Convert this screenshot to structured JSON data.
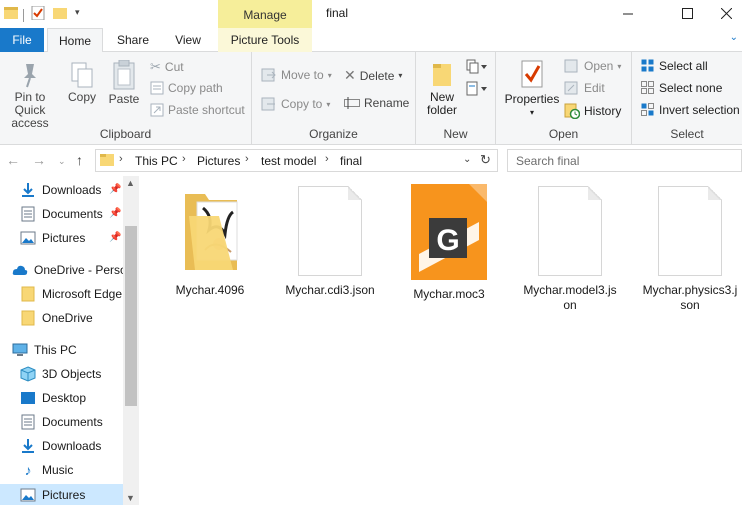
{
  "window": {
    "title": "final",
    "manage_label": "Manage",
    "minimize": "—",
    "maximize": "☐",
    "close": "✕"
  },
  "tabs": {
    "file": "File",
    "home": "Home",
    "share": "Share",
    "view": "View",
    "picture_tools": "Picture Tools"
  },
  "ribbon": {
    "clipboard": {
      "label": "Clipboard",
      "pin_line1": "Pin to Quick",
      "pin_line2": "access",
      "copy": "Copy",
      "paste": "Paste",
      "cut": "Cut",
      "copy_path": "Copy path",
      "paste_shortcut": "Paste shortcut"
    },
    "organize": {
      "label": "Organize",
      "move_to": "Move to",
      "copy_to": "Copy to",
      "delete": "Delete",
      "rename": "Rename"
    },
    "new": {
      "label": "New",
      "new_folder_line1": "New",
      "new_folder_line2": "folder"
    },
    "open": {
      "label": "Open",
      "properties": "Properties",
      "open": "Open",
      "edit": "Edit",
      "history": "History"
    },
    "select": {
      "label": "Select",
      "select_all": "Select all",
      "select_none": "Select none",
      "invert_selection": "Invert selection"
    }
  },
  "address": {
    "crumbs": [
      "This PC",
      "Pictures",
      "test model",
      "final"
    ],
    "search_placeholder": "Search final"
  },
  "sidebar": {
    "quick": [
      {
        "label": "Downloads",
        "icon": "downloads-icon",
        "pinned": true
      },
      {
        "label": "Documents",
        "icon": "documents-icon",
        "pinned": true
      },
      {
        "label": "Pictures",
        "icon": "pictures-icon",
        "pinned": true
      }
    ],
    "onedrive": [
      {
        "label": "OneDrive - Perso",
        "icon": "onedrive-icon"
      },
      {
        "label": "Microsoft Edge",
        "icon": "folder-icon"
      },
      {
        "label": "OneDrive",
        "icon": "folder-icon"
      }
    ],
    "thispc": [
      {
        "label": "This PC",
        "icon": "computer-icon"
      },
      {
        "label": "3D Objects",
        "icon": "3d-objects-icon"
      },
      {
        "label": "Desktop",
        "icon": "desktop-icon"
      },
      {
        "label": "Documents",
        "icon": "documents-icon"
      },
      {
        "label": "Downloads",
        "icon": "downloads-icon"
      },
      {
        "label": "Music",
        "icon": "music-icon"
      },
      {
        "label": "Pictures",
        "icon": "pictures-icon"
      }
    ]
  },
  "files": [
    {
      "name": "Mychar.4096",
      "type": "folder"
    },
    {
      "name": "Mychar.cdi3.json",
      "type": "document"
    },
    {
      "name": "Mychar.moc3",
      "type": "moc3"
    },
    {
      "name": "Mychar.model3.json",
      "type": "document"
    },
    {
      "name": "Mychar.physics3.json",
      "type": "document"
    }
  ],
  "colors": {
    "accent": "#1979ca",
    "manage": "#f6ee9a",
    "selection": "#cce8ff",
    "folder": "#f8d775",
    "moc3": "#f7941d"
  }
}
